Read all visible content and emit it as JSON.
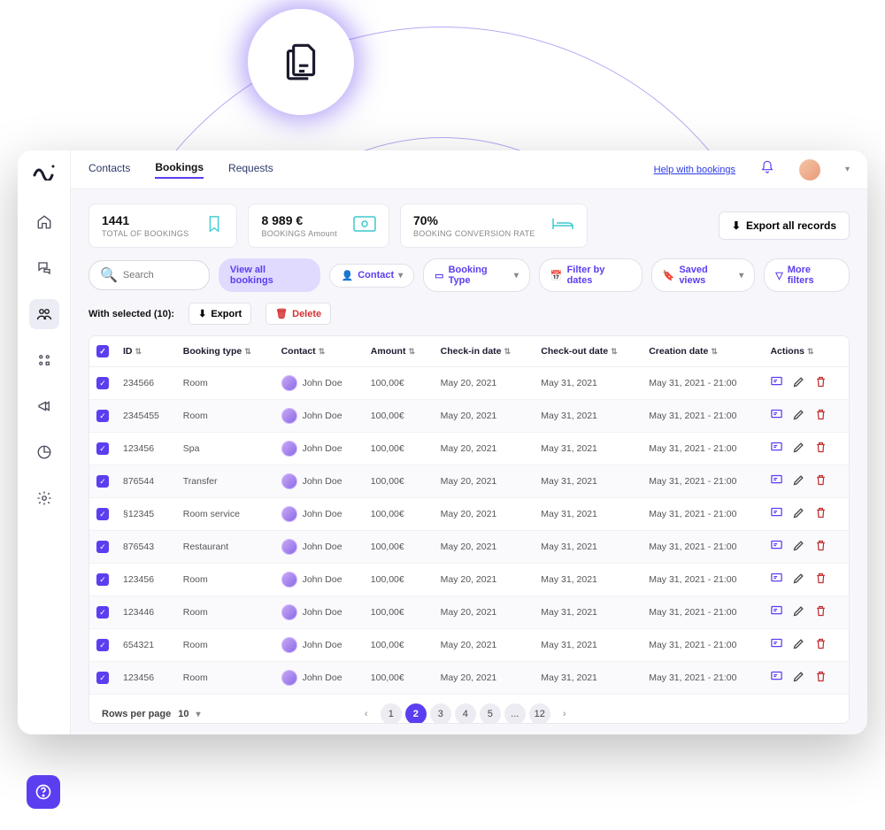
{
  "nav": {
    "tabs": [
      "Contacts",
      "Bookings",
      "Requests"
    ],
    "active": 1,
    "help_link": "Help with bookings"
  },
  "stats": [
    {
      "value": "1441",
      "label": "TOTAL OF BOOKINGS",
      "icon": "bookmark"
    },
    {
      "value": "8 989 €",
      "label": "BOOKINGS Amount",
      "icon": "cash"
    },
    {
      "value": "70%",
      "label": "BOOKING CONVERSION RATE",
      "icon": "bed"
    }
  ],
  "export_all": "Export all records",
  "search_placeholder": "Search",
  "filters": {
    "view_all": "View all bookings",
    "contact": "Contact",
    "booking_type": "Booking Type",
    "filter_dates": "Filter by dates",
    "saved_views": "Saved views",
    "more": "More filters"
  },
  "selection": {
    "label": "With selected (10):",
    "export": "Export",
    "delete": "Delete"
  },
  "columns": [
    "ID",
    "Booking type",
    "Contact",
    "Amount",
    "Check-in date",
    "Check-out date",
    "Creation date",
    "Actions"
  ],
  "rows": [
    {
      "id": "234566",
      "type": "Room",
      "contact": "John Doe",
      "amount": "100,00€",
      "in": "May 20, 2021",
      "out": "May 31, 2021",
      "created": "May 31, 2021 - 21:00"
    },
    {
      "id": "2345455",
      "type": "Room",
      "contact": "John Doe",
      "amount": "100,00€",
      "in": "May 20, 2021",
      "out": "May 31, 2021",
      "created": "May 31, 2021 - 21:00"
    },
    {
      "id": "123456",
      "type": "Spa",
      "contact": "John Doe",
      "amount": "100,00€",
      "in": "May 20, 2021",
      "out": "May 31, 2021",
      "created": "May 31, 2021 - 21:00"
    },
    {
      "id": "876544",
      "type": "Transfer",
      "contact": "John Doe",
      "amount": "100,00€",
      "in": "May 20, 2021",
      "out": "May 31, 2021",
      "created": "May 31, 2021 - 21:00"
    },
    {
      "id": "§12345",
      "type": "Room service",
      "contact": "John Doe",
      "amount": "100,00€",
      "in": "May 20, 2021",
      "out": "May 31, 2021",
      "created": "May 31, 2021 - 21:00"
    },
    {
      "id": "876543",
      "type": "Restaurant",
      "contact": "John Doe",
      "amount": "100,00€",
      "in": "May 20, 2021",
      "out": "May 31, 2021",
      "created": "May 31, 2021 - 21:00"
    },
    {
      "id": "123456",
      "type": "Room",
      "contact": "John Doe",
      "amount": "100,00€",
      "in": "May 20, 2021",
      "out": "May 31, 2021",
      "created": "May 31, 2021 - 21:00"
    },
    {
      "id": "123446",
      "type": "Room",
      "contact": "John Doe",
      "amount": "100,00€",
      "in": "May 20, 2021",
      "out": "May 31, 2021",
      "created": "May 31, 2021 - 21:00"
    },
    {
      "id": "654321",
      "type": "Room",
      "contact": "John Doe",
      "amount": "100,00€",
      "in": "May 20, 2021",
      "out": "May 31, 2021",
      "created": "May 31, 2021 - 21:00"
    },
    {
      "id": "123456",
      "type": "Room",
      "contact": "John Doe",
      "amount": "100,00€",
      "in": "May 20, 2021",
      "out": "May 31, 2021",
      "created": "May 31, 2021 - 21:00"
    }
  ],
  "pager": {
    "rpp_label": "Rows per page",
    "rpp_value": "10",
    "pages": [
      "1",
      "2",
      "3",
      "4",
      "5",
      "...",
      "12"
    ],
    "active": "2"
  }
}
